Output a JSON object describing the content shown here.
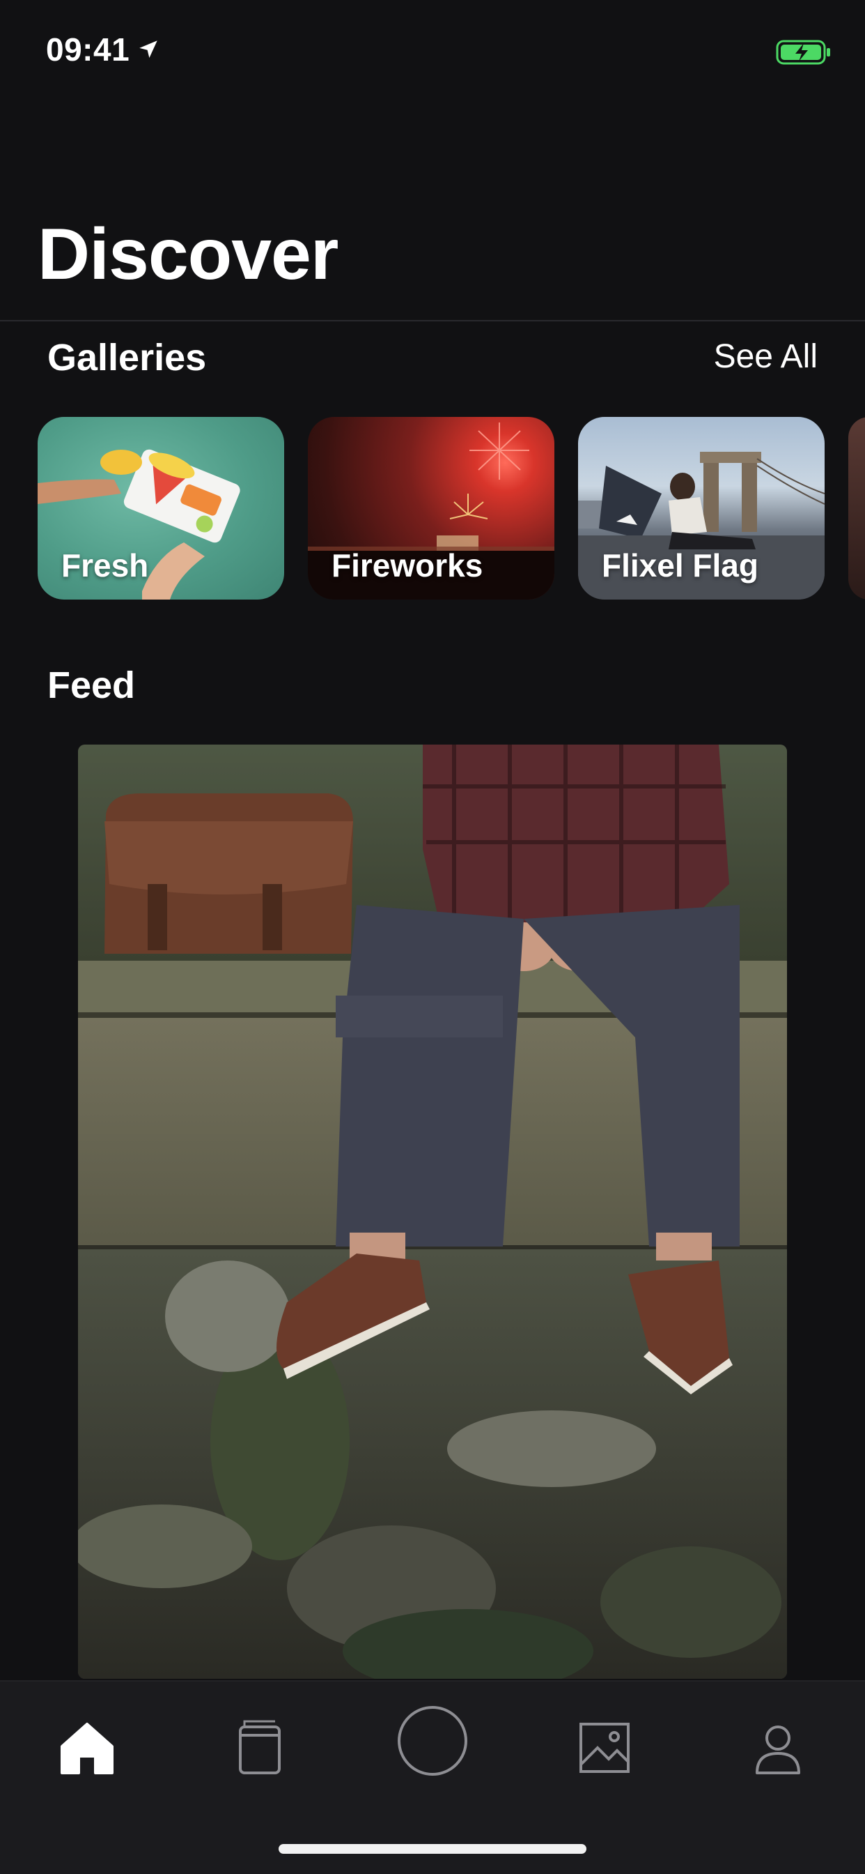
{
  "status_bar": {
    "time": "09:41",
    "battery_color": "#4cd964"
  },
  "header": {
    "title": "Discover"
  },
  "galleries": {
    "title": "Galleries",
    "see_all_label": "See All",
    "items": [
      {
        "label": "Fresh"
      },
      {
        "label": "Fireworks"
      },
      {
        "label": "Flixel Flag"
      }
    ]
  },
  "feed": {
    "title": "Feed"
  },
  "tab_bar": {
    "items": [
      {
        "icon": "home-icon",
        "active": true
      },
      {
        "icon": "book-icon",
        "active": false
      },
      {
        "icon": "capture-circle-icon",
        "active": false
      },
      {
        "icon": "image-icon",
        "active": false
      },
      {
        "icon": "profile-icon",
        "active": false
      }
    ],
    "active_color": "#ffffff",
    "inactive_color": "#8e8e93"
  }
}
